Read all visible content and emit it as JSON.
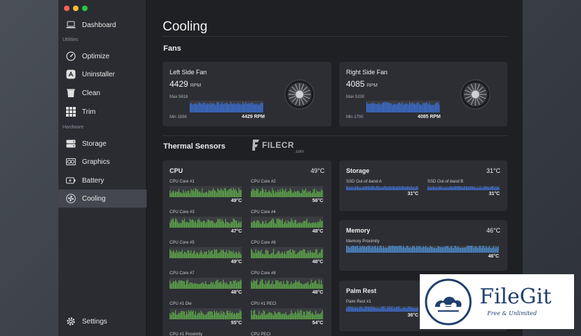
{
  "sidebar": {
    "items": [
      {
        "key": "dashboard",
        "label": "Dashboard",
        "icon": "laptop-icon"
      },
      {
        "key": "optimize",
        "label": "Optimize",
        "icon": "gauge-icon"
      },
      {
        "key": "uninstaller",
        "label": "Uninstaller",
        "icon": "app-store-icon"
      },
      {
        "key": "clean",
        "label": "Clean",
        "icon": "trash-icon"
      },
      {
        "key": "trim",
        "label": "Trim",
        "icon": "grid-icon"
      },
      {
        "key": "storage",
        "label": "Storage",
        "icon": "drive-icon"
      },
      {
        "key": "graphics",
        "label": "Graphics",
        "icon": "gpu-icon"
      },
      {
        "key": "battery",
        "label": "Battery",
        "icon": "battery-icon"
      },
      {
        "key": "cooling",
        "label": "Cooling",
        "icon": "fan-icon"
      }
    ],
    "section_utilities": "Utilities",
    "section_hardware": "Hardware",
    "settings_label": "Settings",
    "active": "cooling"
  },
  "main": {
    "title": "Cooling",
    "fans_title": "Fans",
    "thermal_title": "Thermal Sensors"
  },
  "fans": [
    {
      "name": "Left Side Fan",
      "rpm": "4429",
      "unit": "RPM",
      "max": "Max 5616",
      "min": "Min 1836",
      "current": "4429 RPM",
      "level": 0.77
    },
    {
      "name": "Right Side Fan",
      "rpm": "4085",
      "unit": "RPM",
      "max": "Max 5200",
      "min": "Min 1700",
      "current": "4085 RPM",
      "level": 0.76
    }
  ],
  "cpu": {
    "name": "CPU",
    "temp": "49°C",
    "sensors": [
      {
        "label": "CPU Core #1",
        "value": "49°C"
      },
      {
        "label": "CPU Core #2",
        "value": "56°C"
      },
      {
        "label": "CPU Core #3",
        "value": "47°C"
      },
      {
        "label": "CPU Core #4",
        "value": "48°C"
      },
      {
        "label": "CPU Core #5",
        "value": "49°C"
      },
      {
        "label": "CPU Core #6",
        "value": "48°C"
      },
      {
        "label": "CPU Core #7",
        "value": "48°C"
      },
      {
        "label": "CPU Core #8",
        "value": "48°C"
      },
      {
        "label": "CPU #1 Die",
        "value": "55°C"
      },
      {
        "label": "CPU #1 PECI",
        "value": "54°C"
      },
      {
        "label": "CPU #1 Proximity",
        "value": ""
      },
      {
        "label": "CPU PECI",
        "value": ""
      }
    ]
  },
  "storage": {
    "name": "Storage",
    "temp": "31°C",
    "sensors": [
      {
        "label": "SSD Out-of-band A",
        "value": "31°C"
      },
      {
        "label": "SSD Out-of-band B",
        "value": "31°C"
      }
    ]
  },
  "memory": {
    "name": "Memory",
    "temp": "46°C",
    "sensors": [
      {
        "label": "Memory Proximity",
        "value": "46°C"
      }
    ]
  },
  "palmrest": {
    "name": "Palm Rest",
    "sensors": [
      {
        "label": "Palm Rest #1",
        "value": "36°C"
      }
    ]
  },
  "watermarks": {
    "filecr": "FILECR",
    "filecr_sub": ".com",
    "filegit_name": "FileGit",
    "filegit_tag": "Free & Unlimited"
  },
  "colors": {
    "fan_bar": "#3a6fd8",
    "cpu_bar": "#5fb04a",
    "storage_bar": "#3a6fd8",
    "memory_bar": "#4d8fd6"
  }
}
